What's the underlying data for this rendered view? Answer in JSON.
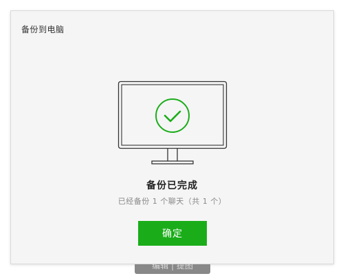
{
  "dialog": {
    "title": "备份到电脑",
    "status_title": "备份已完成",
    "status_detail": "已经备份 1 个聊天（共 1 个）",
    "confirm_label": "确定"
  },
  "hint_bar": {
    "text": "编辑 | 提图"
  },
  "icons": {
    "monitor": "monitor-icon",
    "check": "check-circle-icon"
  },
  "colors": {
    "accent": "#1aad19",
    "dialog_bg": "#f5f5f5",
    "icon_stroke": "#333333"
  }
}
